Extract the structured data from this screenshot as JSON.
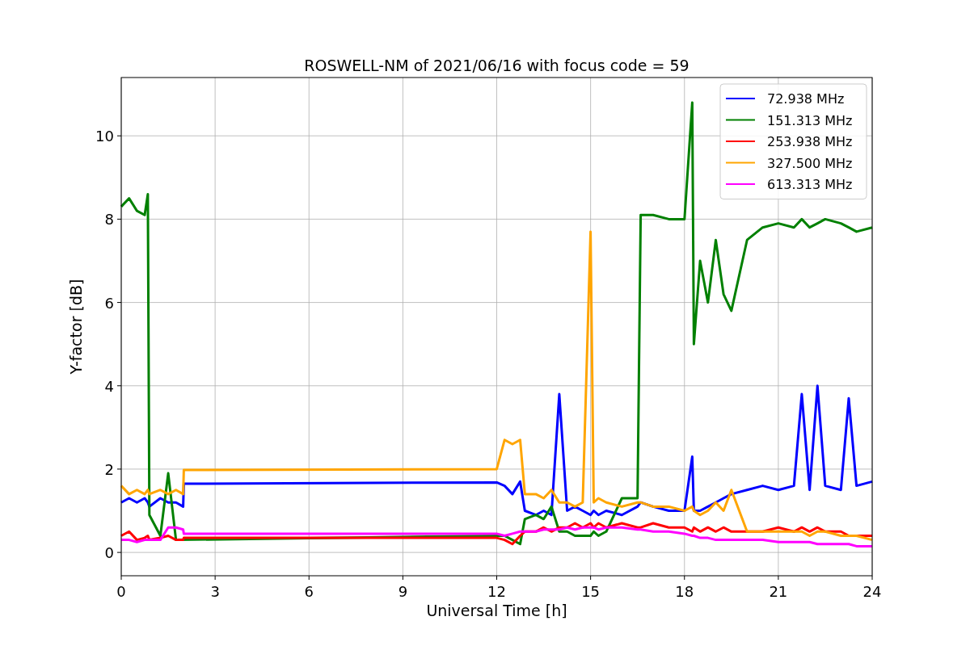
{
  "chart_data": {
    "type": "line",
    "title": "ROSWELL-NM of 2021/06/16 with focus code = 59",
    "xlabel": "Universal Time [h]",
    "ylabel": "Y-factor [dB]",
    "x": [
      0,
      0.25,
      0.5,
      0.75,
      0.85,
      0.9,
      1.25,
      1.5,
      1.75,
      1.98,
      2.0,
      12,
      12.25,
      12.5,
      12.75,
      12.9,
      13.25,
      13.5,
      13.75,
      14,
      14.25,
      14.5,
      14.75,
      15,
      15.1,
      15.25,
      15.5,
      16,
      16.5,
      16.6,
      17,
      17.5,
      18,
      18.25,
      18.3,
      18.5,
      18.75,
      19,
      19.25,
      19.5,
      20,
      20.5,
      21,
      21.5,
      21.75,
      22,
      22.25,
      22.5,
      23,
      23.25,
      23.5,
      24
    ],
    "series": [
      {
        "name": " 72.938 MHz",
        "color": "#0000ff",
        "values": [
          1.2,
          1.3,
          1.2,
          1.3,
          1.2,
          1.1,
          1.3,
          1.2,
          1.2,
          1.1,
          1.65,
          1.68,
          1.6,
          1.4,
          1.7,
          1.0,
          0.9,
          1.0,
          0.9,
          3.8,
          1.0,
          1.1,
          1.0,
          0.9,
          1.0,
          0.9,
          1.0,
          0.9,
          1.1,
          1.2,
          1.1,
          1.0,
          1.0,
          2.3,
          1.0,
          1.0,
          1.1,
          1.2,
          1.3,
          1.4,
          1.5,
          1.6,
          1.5,
          1.6,
          3.8,
          1.5,
          4.0,
          1.6,
          1.5,
          3.7,
          1.6,
          1.7
        ]
      },
      {
        "name": "151.313 MHz",
        "color": "#008000",
        "values": [
          8.3,
          8.5,
          8.2,
          8.1,
          8.6,
          0.9,
          0.4,
          1.9,
          0.3,
          null,
          null,
          0.4,
          0.4,
          0.3,
          0.2,
          0.8,
          0.9,
          0.8,
          1.1,
          0.5,
          0.5,
          0.4,
          0.4,
          0.4,
          0.5,
          0.4,
          0.5,
          1.3,
          1.3,
          8.1,
          8.1,
          8.0,
          8.0,
          10.8,
          5.0,
          7.0,
          6.0,
          7.5,
          6.2,
          5.8,
          7.5,
          7.8,
          7.9,
          7.8,
          8.0,
          7.8,
          7.9,
          8.0,
          7.9,
          7.8,
          7.7,
          7.8
        ]
      },
      {
        "name": "253.938 MHz",
        "color": "#ff0000",
        "values": [
          0.4,
          0.5,
          0.3,
          0.35,
          0.4,
          0.3,
          0.35,
          0.4,
          0.3,
          0.3,
          0.35,
          0.35,
          0.3,
          0.2,
          0.4,
          0.5,
          0.5,
          0.6,
          0.5,
          0.6,
          0.6,
          0.7,
          0.6,
          0.7,
          0.6,
          0.7,
          0.6,
          0.7,
          0.6,
          0.6,
          0.7,
          0.6,
          0.6,
          0.5,
          0.6,
          0.5,
          0.6,
          0.5,
          0.6,
          0.5,
          0.5,
          0.5,
          0.6,
          0.5,
          0.6,
          0.5,
          0.6,
          0.5,
          0.5,
          0.4,
          0.4,
          0.4
        ]
      },
      {
        "name": "327.500 MHz",
        "color": "#ffa500",
        "values": [
          1.6,
          1.4,
          1.5,
          1.4,
          1.5,
          1.4,
          1.5,
          1.4,
          1.5,
          1.4,
          1.98,
          2.0,
          2.7,
          2.6,
          2.7,
          1.4,
          1.4,
          1.3,
          1.5,
          1.2,
          1.2,
          1.1,
          1.2,
          7.7,
          1.2,
          1.3,
          1.2,
          1.1,
          1.2,
          1.2,
          1.1,
          1.1,
          1.0,
          1.1,
          1.0,
          0.9,
          1.0,
          1.2,
          1.0,
          1.5,
          0.5,
          0.5,
          0.5,
          0.5,
          0.5,
          0.4,
          0.5,
          0.5,
          0.4,
          0.4,
          0.4,
          0.3
        ]
      },
      {
        "name": "613.313 MHz",
        "color": "#ff00ff",
        "values": [
          0.3,
          0.3,
          0.25,
          0.3,
          0.3,
          0.3,
          0.3,
          0.6,
          0.6,
          0.55,
          0.45,
          0.45,
          0.4,
          0.45,
          0.5,
          0.5,
          0.5,
          0.55,
          0.55,
          0.55,
          0.6,
          0.55,
          0.6,
          0.6,
          0.6,
          0.55,
          0.6,
          0.6,
          0.55,
          0.55,
          0.5,
          0.5,
          0.45,
          0.4,
          0.4,
          0.35,
          0.35,
          0.3,
          0.3,
          0.3,
          0.3,
          0.3,
          0.25,
          0.25,
          0.25,
          0.25,
          0.2,
          0.2,
          0.2,
          0.2,
          0.15,
          0.15
        ]
      }
    ],
    "grid": true,
    "legend": "upper right",
    "xlim": [
      0,
      24
    ],
    "ylim": [
      -0.56,
      11.4
    ],
    "xticks": [
      0,
      3,
      6,
      9,
      12,
      15,
      18,
      21,
      24
    ],
    "yticks": [
      0,
      2,
      4,
      6,
      8,
      10
    ]
  }
}
